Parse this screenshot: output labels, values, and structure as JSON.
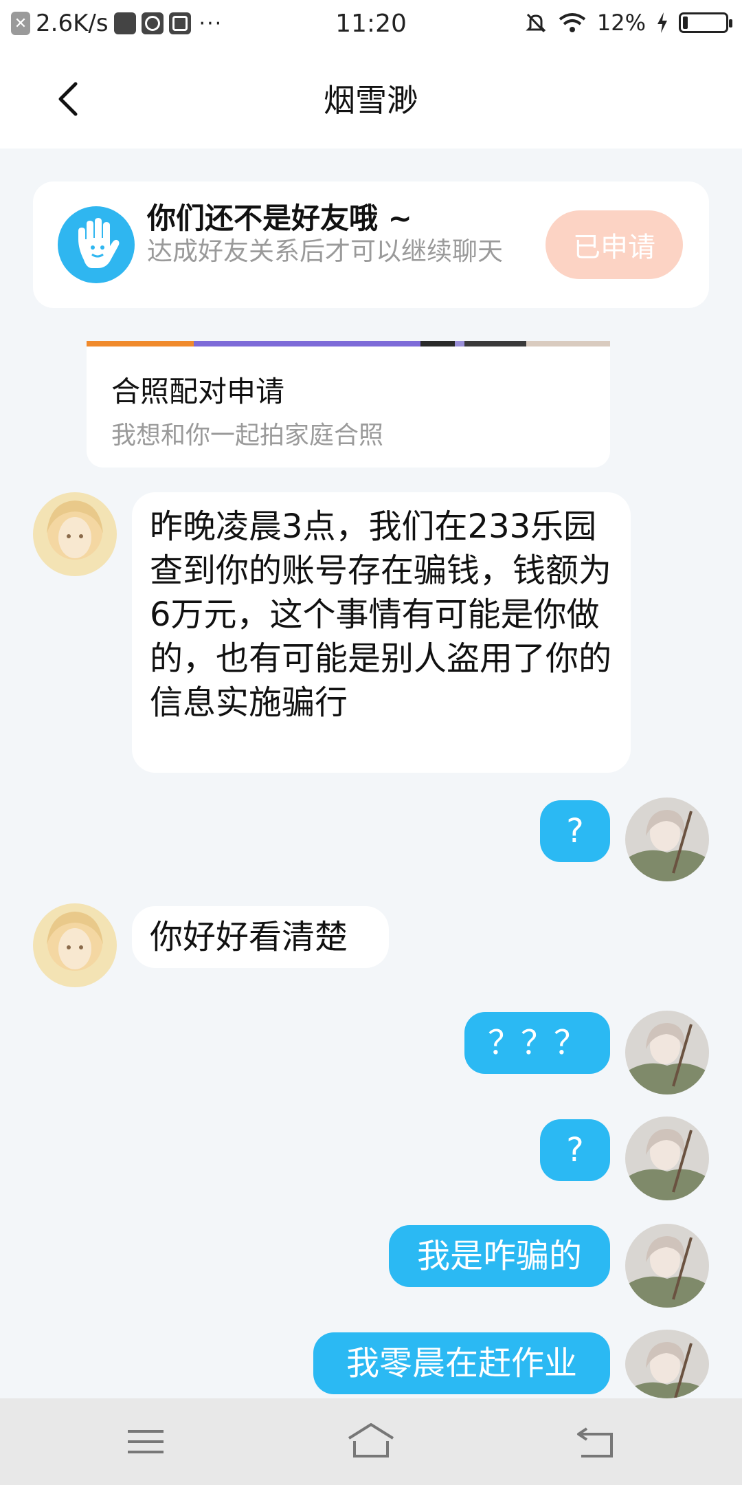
{
  "status_bar": {
    "speed": "2.6K/s",
    "dots": "···",
    "time": "11:20",
    "battery": "12%",
    "battery_level": 0.12
  },
  "header": {
    "title": "烟雪渺"
  },
  "friend_notice": {
    "title": "你们还不是好友哦 ~",
    "subtitle": "达成好友关系后才可以继续聊天",
    "button": "已申请"
  },
  "pair_card": {
    "title": "合照配对申请",
    "subtitle": "我想和你一起拍家庭合照"
  },
  "messages": [
    {
      "side": "left",
      "text": "昨晚凌晨3点，我们在233乐园查到你的账号存在骗钱，钱额为6万元，这个事情有可能是你做的，也有可能是别人盗用了你的信息实施骗行"
    },
    {
      "side": "right",
      "text": "?"
    },
    {
      "side": "left",
      "text": "你好好看清楚"
    },
    {
      "side": "right",
      "text": "？？？"
    },
    {
      "side": "right",
      "text": "?"
    },
    {
      "side": "right",
      "text": "我是咋骗的"
    },
    {
      "side": "right",
      "text": "我零晨在赶作业"
    }
  ],
  "colors": {
    "accent_blue": "#2bb9f3",
    "applied_button": "#fcd3c4",
    "background": "#f3f6f9"
  },
  "icons": {
    "back": "chevron-left-icon",
    "hand": "hand-wave-icon",
    "nav_menu": "menu-icon",
    "nav_home": "home-icon",
    "nav_back": "return-icon"
  }
}
